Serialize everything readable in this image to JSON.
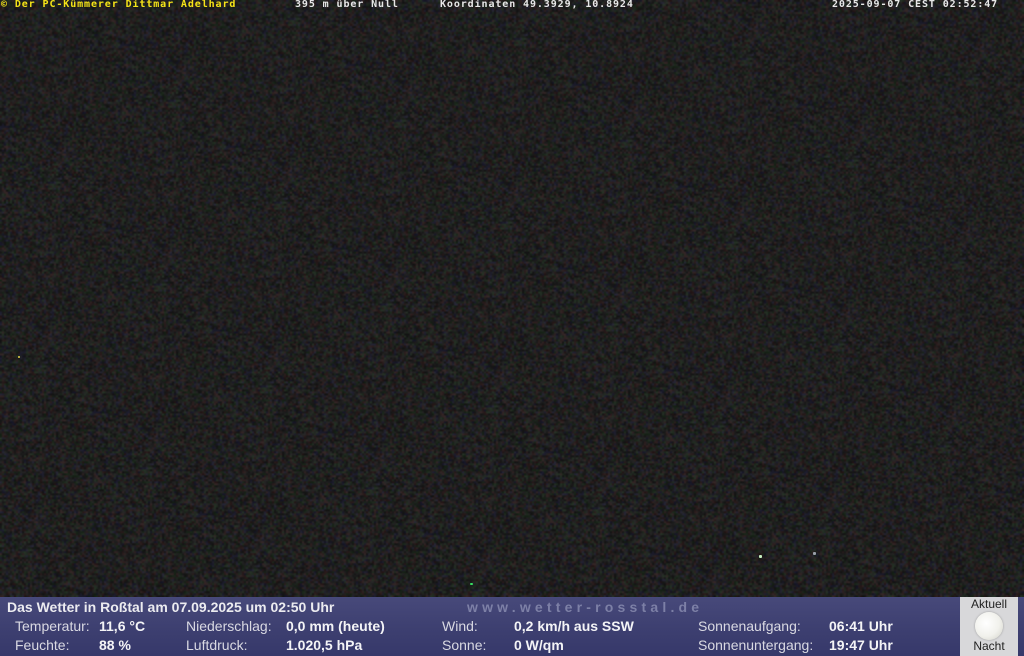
{
  "caption": {
    "copyright": "© Der PC-Kümmerer Dittmar Adelhard",
    "altitude": "395 m über Null",
    "coordinates": "Koordinaten 49.3929, 10.8924",
    "timestamp": "2025-09-07 CEST 02:52:47"
  },
  "weather": {
    "title": "Das Wetter in Roßtal am 07.09.2025 um 02:50 Uhr",
    "website": "www.wetter-rosstal.de",
    "temperature_label": "Temperatur:",
    "temperature_value": "11,6 °C",
    "humidity_label": "Feuchte:",
    "humidity_value": "88 %",
    "precipitation_label": "Niederschlag:",
    "precipitation_value": "0,0 mm (heute)",
    "pressure_label": "Luftdruck:",
    "pressure_value": "1.020,5 hPa",
    "wind_label": "Wind:",
    "wind_value": "0,2 km/h aus SSW",
    "sun_label": "Sonne:",
    "sun_value": "0 W/qm",
    "sunrise_label": "Sonnenaufgang:",
    "sunrise_value": "06:41 Uhr",
    "sunset_label": "Sonnenuntergang:",
    "sunset_value": "19:47 Uhr"
  },
  "moon": {
    "top_label": "Aktuell",
    "bottom_label": "Nacht",
    "icon": "full-moon-icon"
  },
  "colors": {
    "caption_accent": "#f6e418",
    "bar_background": "#43457a"
  }
}
